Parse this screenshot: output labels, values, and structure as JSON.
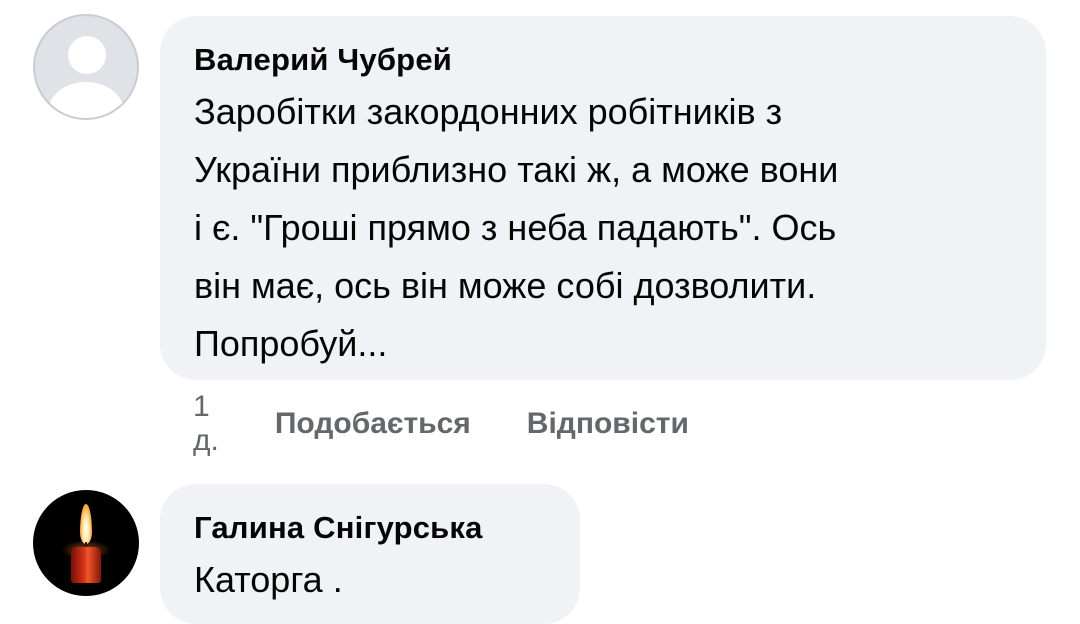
{
  "comments": [
    {
      "author": "Валерий Чубрей",
      "avatar": "default-user-icon",
      "text": "Заробітки закордонних робітників з\nУкраїни приблизно такі ж, а може вони\nі є. \"Гроші прямо з неба падають\". Ось\nвін має, ось він може собі дозволити.\nПопробуй...",
      "time": "1 д.",
      "like_label": "Подобається",
      "reply_label": "Відповісти"
    },
    {
      "author": "Галина Снігурська",
      "avatar": "candle-icon",
      "text": "Каторга ."
    }
  ],
  "colors": {
    "bubble_bg": "#f0f2f5",
    "text": "#050505",
    "meta": "#65676b"
  }
}
